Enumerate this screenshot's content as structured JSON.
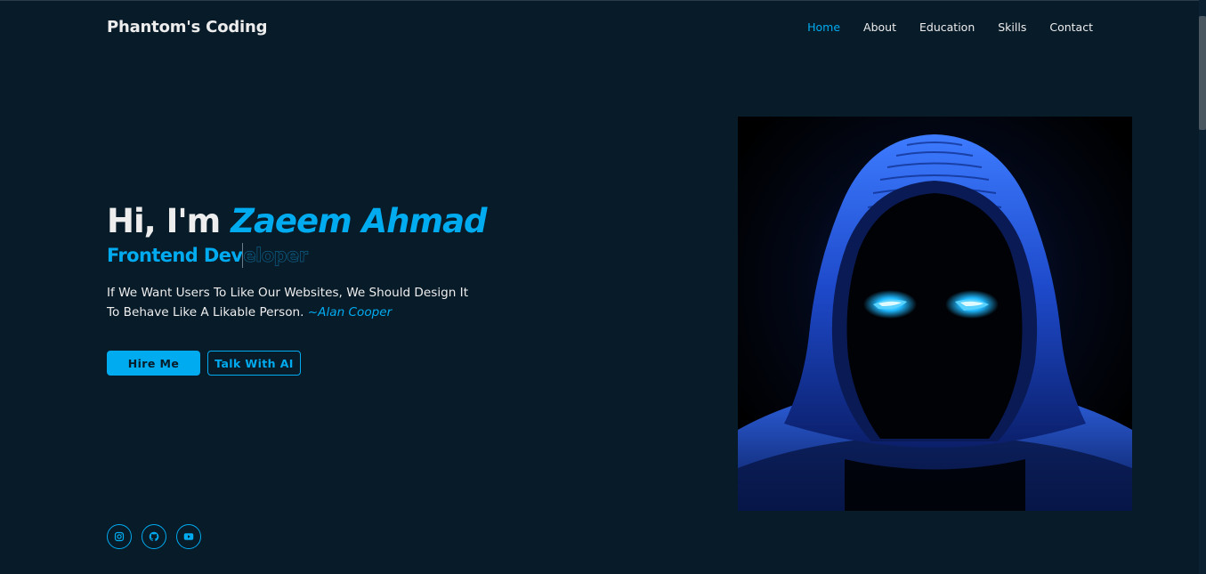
{
  "header": {
    "logo": "Phantom's Coding",
    "nav": [
      "Home",
      "About",
      "Education",
      "Skills",
      "Contact"
    ],
    "active_index": 0
  },
  "hero": {
    "greeting": "Hi, I'm",
    "name": "Zaeem Ahmad",
    "role_typed": "Frontend Dev",
    "role_remaining": "eloper",
    "quote": "If We Want Users To Like Our Websites, We Should Design It To Behave Like A Likable Person.",
    "quote_author": "~Alan Cooper",
    "primary_button": "Hire Me",
    "secondary_button": "Talk With AI"
  },
  "socials": [
    {
      "icon": "instagram-icon"
    },
    {
      "icon": "github-icon"
    },
    {
      "icon": "youtube-icon"
    }
  ],
  "colors": {
    "background": "#081b29",
    "accent": "#00abf0",
    "text": "#ededed"
  }
}
